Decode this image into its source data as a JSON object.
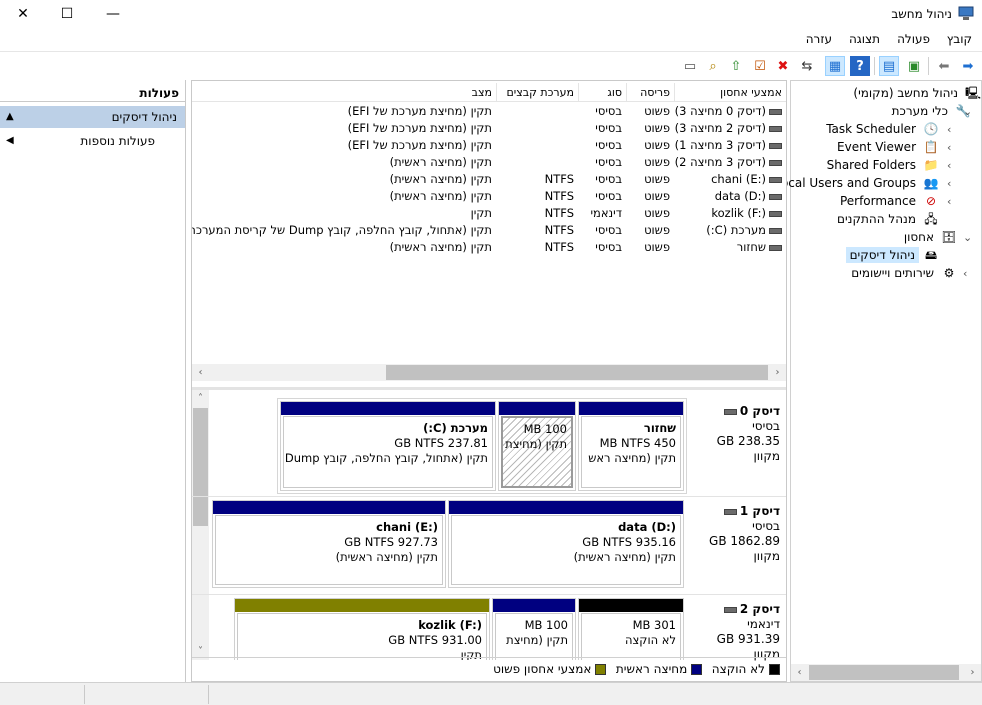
{
  "window": {
    "title": "ניהול מחשב",
    "close_glyph": "✕",
    "maximize_glyph": "☐",
    "minimize_glyph": "—"
  },
  "menu": [
    "קובץ",
    "פעולה",
    "תצוגה",
    "עזרה"
  ],
  "tree": {
    "root": "ניהול מחשב (מקומי)",
    "system_tools": "כלי מערכת",
    "task_scheduler": "Task Scheduler",
    "event_viewer": "Event Viewer",
    "shared_folders": "Shared Folders",
    "local_users": "Local Users and Groups",
    "performance": "Performance",
    "device_manager": "מנהל ההתקנים",
    "storage": "אחסון",
    "disk_management": "ניהול דיסקים",
    "services": "שירותים ויישומים"
  },
  "volume_table": {
    "headers": [
      "אמצעי אחסון",
      "פריסה",
      "סוג",
      "מערכת קבצים",
      "מצב"
    ],
    "rows": [
      [
        "(דיסק 0 מחיצה 3)",
        "פשוט",
        "בסיסי",
        "",
        "תקין (מחיצת מערכת של EFI)"
      ],
      [
        "(דיסק 2 מחיצה 3)",
        "פשוט",
        "בסיסי",
        "",
        "תקין (מחיצת מערכת של EFI)"
      ],
      [
        "(דיסק 3 מחיצה 1)",
        "פשוט",
        "בסיסי",
        "",
        "תקין (מחיצת מערכת של EFI)"
      ],
      [
        "(דיסק 3 מחיצה 2)",
        "פשוט",
        "בסיסי",
        "",
        "תקין (מחיצה ראשית)"
      ],
      [
        "chani (E:)",
        "פשוט",
        "בסיסי",
        "NTFS",
        "תקין (מחיצה ראשית)"
      ],
      [
        "data (D:)",
        "פשוט",
        "בסיסי",
        "NTFS",
        "תקין (מחיצה ראשית)"
      ],
      [
        "kozlik (F:)",
        "פשוט",
        "דינאמי",
        "NTFS",
        "תקין"
      ],
      [
        "מערכת (C:)",
        "פשוט",
        "בסיסי",
        "NTFS",
        "תקין (אתחול, קובץ החלפה, קובץ Dump של קריסת המערכת)"
      ],
      [
        "שחזור",
        "פשוט",
        "בסיסי",
        "NTFS",
        "תקין (מחיצה ראשית)"
      ]
    ]
  },
  "disks": [
    {
      "name": "דיסק 0",
      "type": "בסיסי",
      "size": "238.35 GB",
      "status": "מקוון",
      "partitions": [
        {
          "title": "שחזור",
          "size": "450 MB NTFS",
          "status": "תקין (מחיצה ראש"
        },
        {
          "title": "",
          "size": "100 MB",
          "status": "תקין (מחיצת"
        },
        {
          "title": "מערכת  (C:)",
          "size": "237.81 GB NTFS",
          "status": "תקין (אתחול, קובץ החלפה, קובץ Dump"
        }
      ]
    },
    {
      "name": "דיסק 1",
      "type": "בסיסי",
      "size": "1862.89 GB",
      "status": "מקוון",
      "partitions": [
        {
          "title": "data  (D:)",
          "size": "935.16 GB NTFS",
          "status": "תקין (מחיצה ראשית)"
        },
        {
          "title": "chani  (E:)",
          "size": "927.73 GB NTFS",
          "status": "תקין (מחיצה ראשית)"
        }
      ]
    },
    {
      "name": "דיסק 2",
      "type": "דינאמי",
      "size": "931.39 GB",
      "status": "מקוון",
      "partitions": [
        {
          "title": "",
          "size": "301 MB",
          "status": "לא הוקצה"
        },
        {
          "title": "",
          "size": "100 MB",
          "status": "תקין (מחיצת"
        },
        {
          "title": "kozlik  (F:)",
          "size": "931.00 GB NTFS",
          "status": "תקין"
        }
      ]
    }
  ],
  "legend": [
    "לא הוקצה",
    "מחיצה ראשית",
    "אמצעי אחסון פשוט"
  ],
  "colors": {
    "unallocated": "#000000",
    "primary": "#000080",
    "simple": "#808000",
    "selection": "#cce8ff",
    "actions_highlight": "#bcd0e7"
  },
  "actions": {
    "header": "פעולות",
    "disk_management": "ניהול דיסקים",
    "more_actions": "פעולות נוספות"
  }
}
